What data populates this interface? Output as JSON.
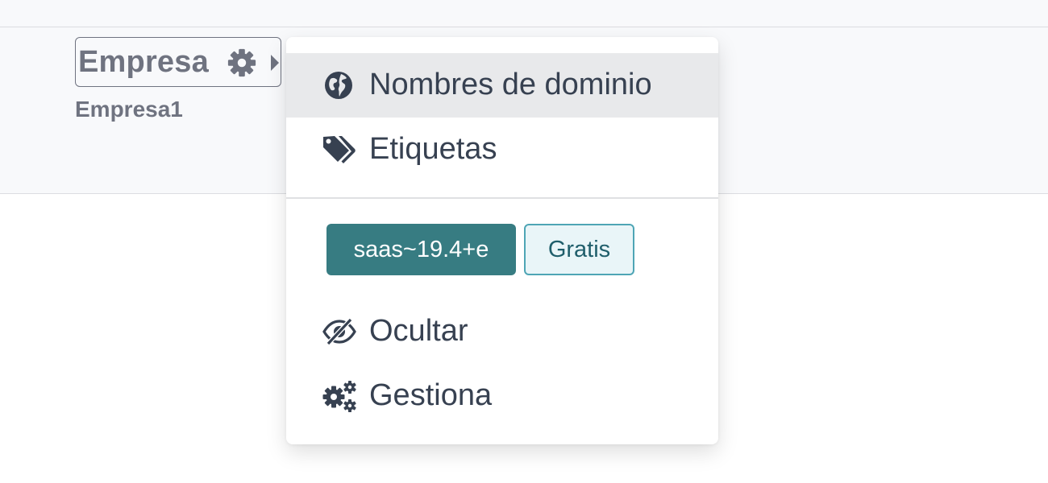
{
  "header": {
    "database_name": "Empresa",
    "database_subtitle": "Empresa1",
    "settings_icon": "gear-icon",
    "caret_icon": "caret-right-icon"
  },
  "dropdown": {
    "items": [
      {
        "label": "Nombres de dominio",
        "icon": "globe-icon",
        "active": true
      },
      {
        "label": "Etiquetas",
        "icon": "tags-icon",
        "active": false
      },
      {
        "label": "Ocultar",
        "icon": "eye-slash-icon",
        "active": false
      },
      {
        "label": "Gestiona",
        "icon": "gears-icon",
        "active": false
      }
    ],
    "version_badge": "saas~19.4+e",
    "plan_badge": "Gratis"
  },
  "colors": {
    "text_dark": "#374151",
    "text_muted": "#6f7380",
    "accent_teal": "#377c82",
    "plan_border": "#4ea5b5",
    "plan_bg": "#e9f5f8",
    "active_row": "#e8e9eb"
  }
}
